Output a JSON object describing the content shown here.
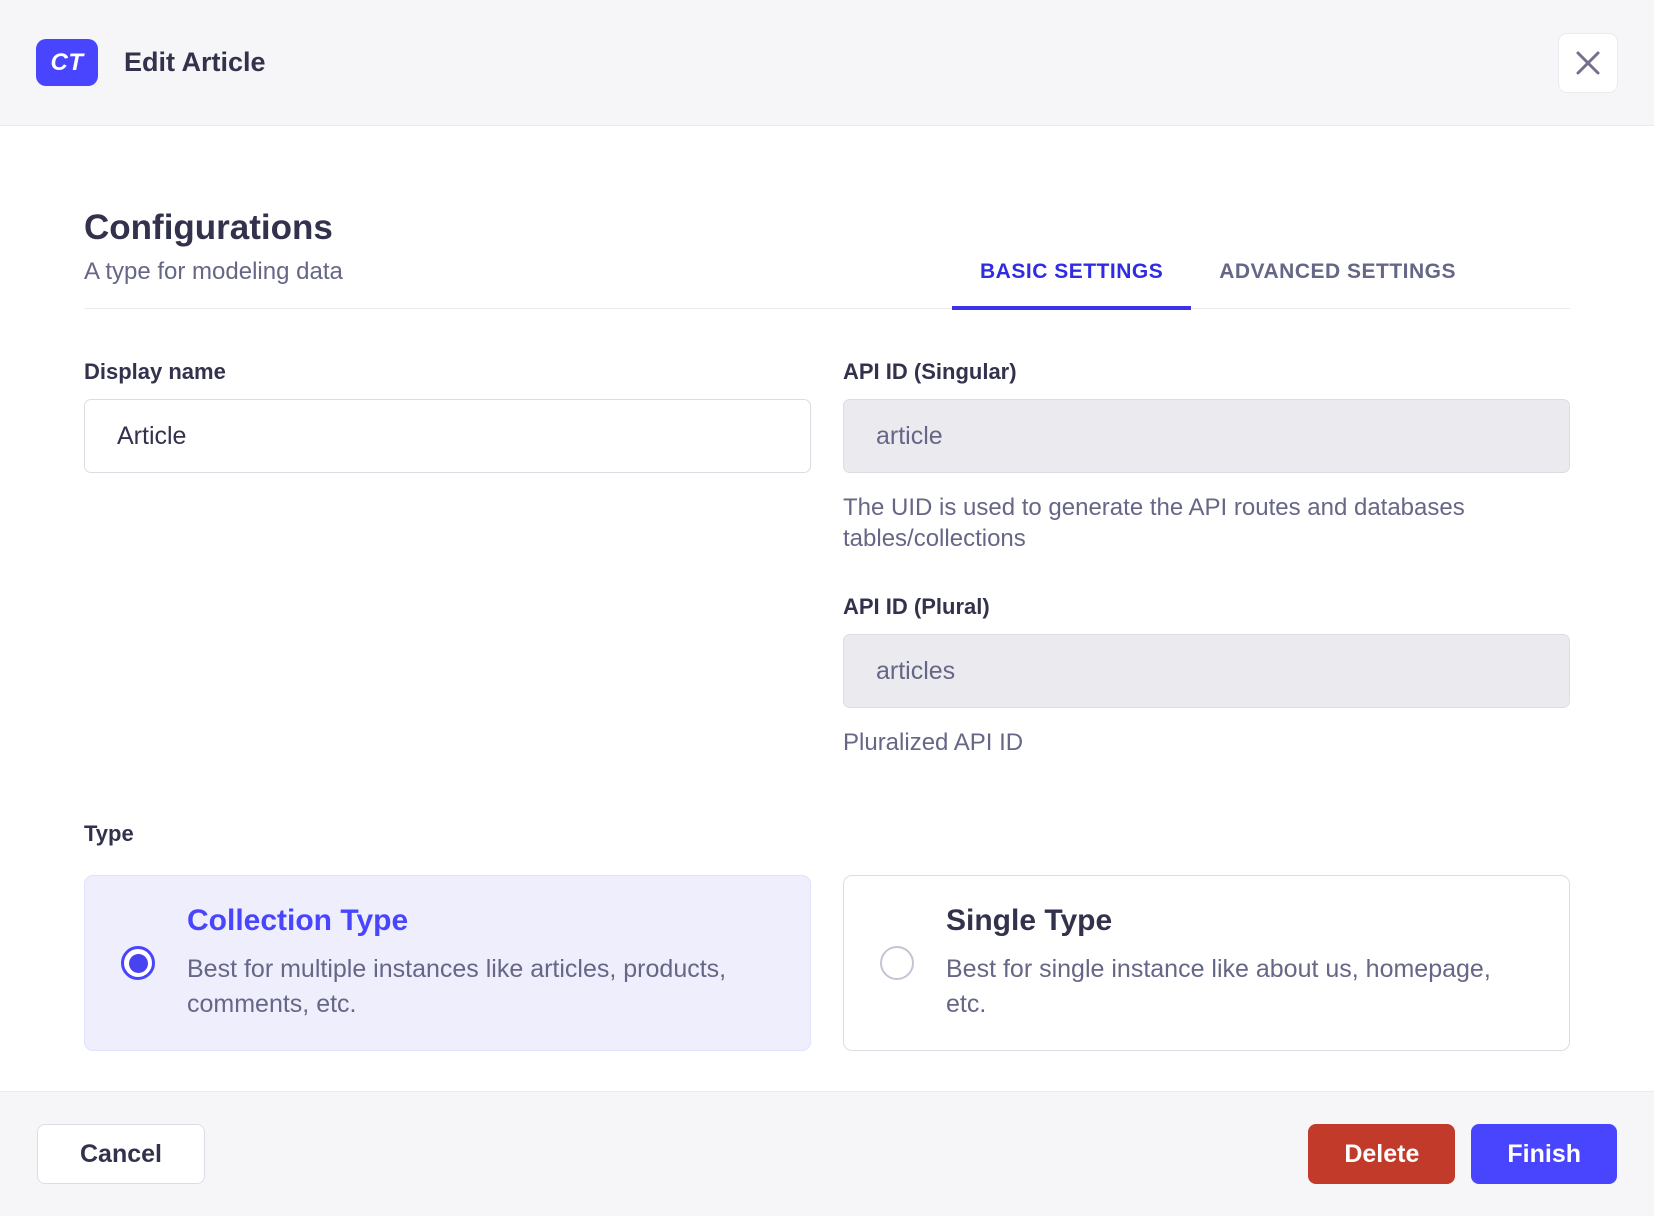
{
  "header": {
    "badge": "CT",
    "title": "Edit Article"
  },
  "section": {
    "title": "Configurations",
    "subtitle": "A type for modeling data"
  },
  "tabs": [
    {
      "label": "BASIC SETTINGS",
      "active": true
    },
    {
      "label": "ADVANCED SETTINGS",
      "active": false
    }
  ],
  "fields": {
    "display_name": {
      "label": "Display name",
      "value": "Article"
    },
    "api_singular": {
      "label": "API ID (Singular)",
      "value": "article",
      "helper": "The UID is used to generate the API routes and databases tables/collections"
    },
    "api_plural": {
      "label": "API ID (Plural)",
      "value": "articles",
      "helper": "Pluralized API ID"
    }
  },
  "type_section": {
    "label": "Type",
    "options": [
      {
        "title": "Collection Type",
        "description": "Best for multiple instances like articles, products, comments, etc.",
        "selected": true
      },
      {
        "title": "Single Type",
        "description": "Best for single instance like about us, homepage, etc.",
        "selected": false
      }
    ]
  },
  "footer": {
    "cancel": "Cancel",
    "delete": "Delete",
    "finish": "Finish"
  },
  "colors": {
    "primary": "#4945ff",
    "tab_active": "#2f2ce2",
    "danger": "#c23a29",
    "surface_gray": "#f6f6f9",
    "border_light": "#eaeaef",
    "input_border": "#dcdce4",
    "disabled_bg": "#eaeaef",
    "text_dark": "#32324d",
    "text_gray": "#666687",
    "selected_card_bg": "#eeeefc"
  }
}
